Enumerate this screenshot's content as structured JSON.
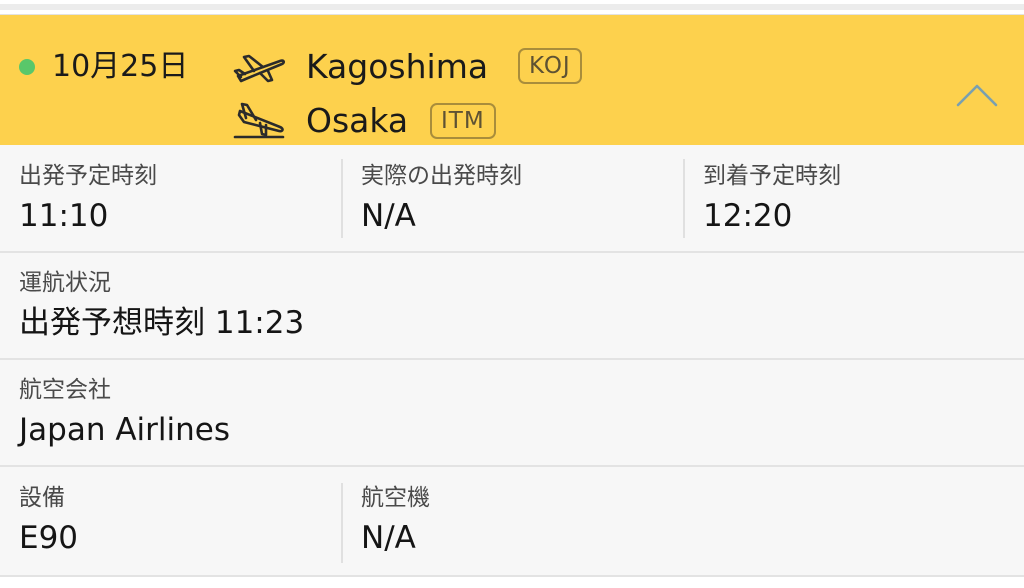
{
  "header": {
    "date": "10月25日",
    "status_color": "#59c76a",
    "background_color": "#fdd14d",
    "origin": {
      "city": "Kagoshima",
      "code": "KOJ"
    },
    "destination": {
      "city": "Osaka",
      "code": "ITM"
    },
    "collapse_icon": "chevron-up-icon",
    "departure_icon": "plane-takeoff-icon",
    "arrival_icon": "plane-landing-icon"
  },
  "details": {
    "scheduled_departure": {
      "label": "出発予定時刻",
      "value": "11:10"
    },
    "actual_departure": {
      "label": "実際の出発時刻",
      "value": "N/A"
    },
    "scheduled_arrival": {
      "label": "到着予定時刻",
      "value": "12:20"
    },
    "flight_status": {
      "label": "運航状況",
      "value": "出発予想時刻 11:23"
    },
    "airline": {
      "label": "航空会社",
      "value": "Japan Airlines"
    },
    "equipment": {
      "label": "設備",
      "value": "E90"
    },
    "aircraft": {
      "label": "航空機",
      "value": "N/A"
    }
  }
}
